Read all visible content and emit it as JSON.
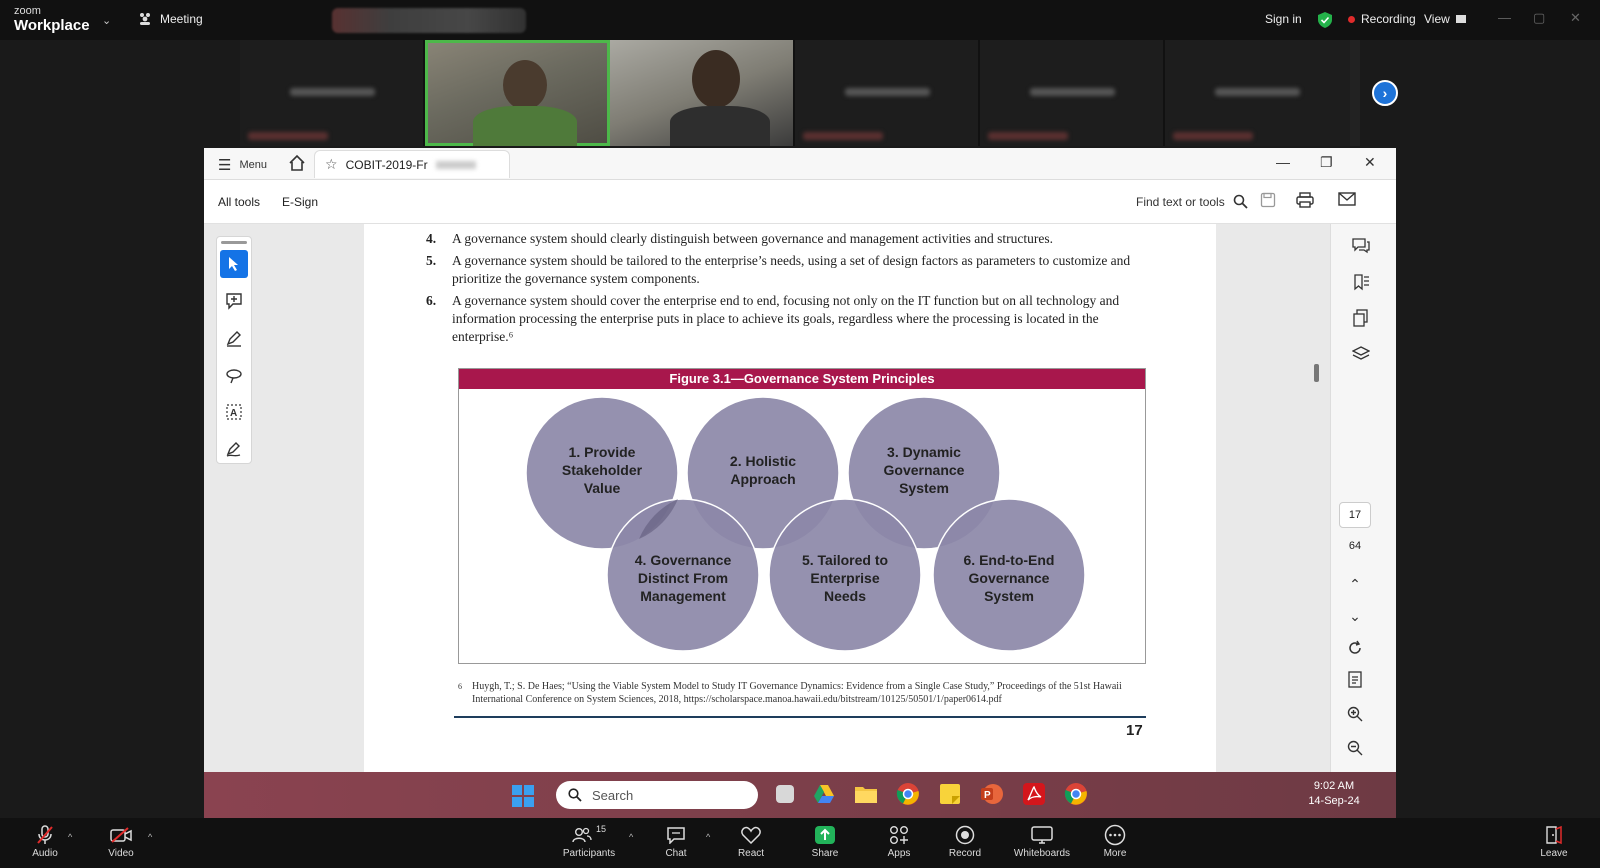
{
  "zoom": {
    "brand_small": "zoom",
    "brand_big": "Workplace",
    "meeting_label": "Meeting",
    "sign_in": "Sign in",
    "recording": "Recording",
    "view": "View"
  },
  "acrobat": {
    "menu_label": "Menu",
    "tab_title": "COBIT-2019-Fr",
    "tools": {
      "all_tools": "All tools",
      "esign": "E-Sign"
    },
    "find_label": "Find text or tools",
    "current_page": "17",
    "total_pages": "64"
  },
  "document": {
    "items": [
      {
        "num": "4.",
        "text": "A governance system should clearly distinguish between governance and management activities and structures."
      },
      {
        "num": "5.",
        "text": "A governance system should be tailored to the enterprise’s needs, using a set of design factors as parameters to customize and prioritize the governance system components."
      },
      {
        "num": "6.",
        "text": "A governance system should cover the enterprise end to end, focusing not only on the IT function but on all technology and information processing the enterprise puts in place to achieve its goals, regardless where the processing is located in the enterprise.⁶"
      }
    ],
    "figure_title": "Figure 3.1—Governance System Principles",
    "circles": [
      {
        "l1": "1. Provide",
        "l2": "Stakeholder",
        "l3": "Value"
      },
      {
        "l1": "2. Holistic",
        "l2": "Approach",
        "l3": ""
      },
      {
        "l1": "3. Dynamic",
        "l2": "Governance",
        "l3": "System"
      },
      {
        "l1": "4. Governance",
        "l2": "Distinct From",
        "l3": "Management"
      },
      {
        "l1": "5. Tailored to",
        "l2": "Enterprise",
        "l3": "Needs"
      },
      {
        "l1": "6. End-to-End",
        "l2": "Governance",
        "l3": "System"
      }
    ],
    "footnote_mark": "6",
    "footnote": "Huygh, T.; S. De Haes; “Using the Viable System Model to Study IT Governance Dynamics: Evidence from a Single Case Study,” Proceedings of the 51st Hawaii International Conference on System Sciences, 2018, https://scholarspace.manoa.hawaii.edu/bitstream/10125/50501/1/paper0614.pdf",
    "page_number": "17"
  },
  "taskbar": {
    "search_placeholder": "Search",
    "time": "9:02 AM",
    "date": "14-Sep-24"
  },
  "controls": {
    "audio": "Audio",
    "video": "Video",
    "participants": "Participants",
    "participants_count": "15",
    "chat": "Chat",
    "react": "React",
    "share": "Share",
    "apps": "Apps",
    "record": "Record",
    "whiteboards": "Whiteboards",
    "more": "More",
    "leave": "Leave"
  },
  "colors": {
    "figure_header": "#a8174c",
    "circle_fill": "#8c88a8",
    "recording_dot": "#e02b2b",
    "share_green": "#22b35a",
    "zoom_blue": "#1e73d8"
  }
}
